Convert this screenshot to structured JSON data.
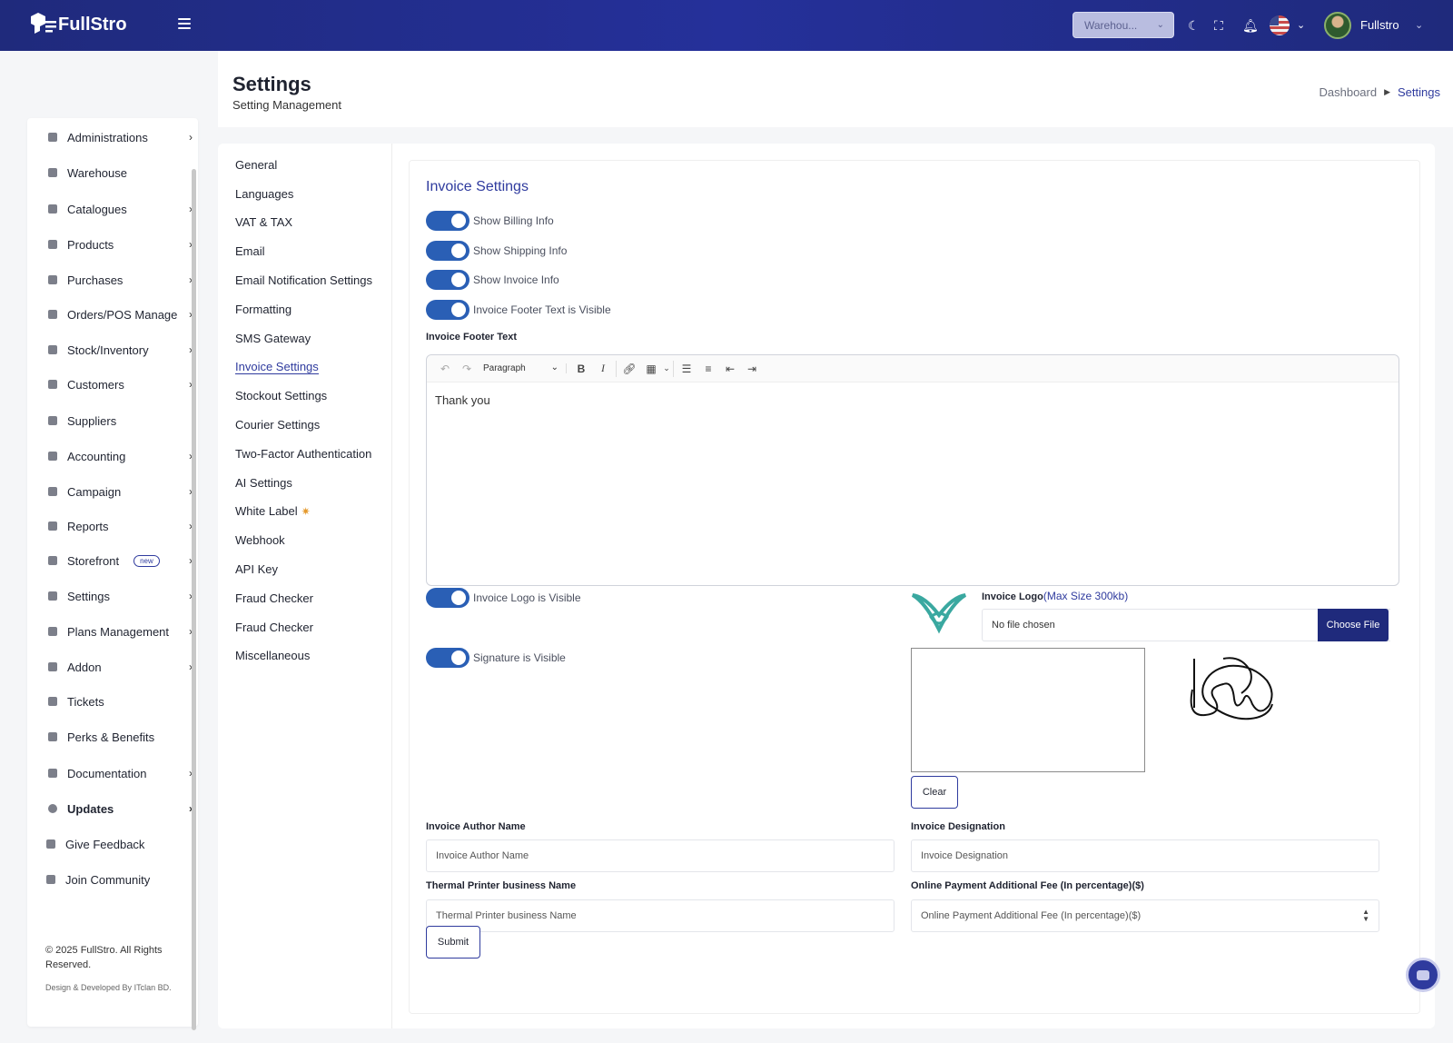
{
  "topbar": {
    "brand": "FullStro",
    "warehouse_select": "Warehou...",
    "user_name": "Fullstro",
    "icons": [
      "menu-icon",
      "moon-icon",
      "fullscreen-icon",
      "bell-icon",
      "flag-icon",
      "chevron-down-icon"
    ]
  },
  "header": {
    "title": "Settings",
    "subtitle": "Setting Management",
    "breadcrumb": {
      "home": "Dashboard",
      "current": "Settings"
    }
  },
  "sidebar": {
    "items": [
      {
        "label": "Administrations",
        "arrow": "›"
      },
      {
        "label": "Warehouse",
        "arrow": ""
      },
      {
        "label": "Catalogues",
        "arrow": "›"
      },
      {
        "label": "Products",
        "arrow": "›"
      },
      {
        "label": "Purchases",
        "arrow": "›"
      },
      {
        "label": "Orders/POS Manage",
        "arrow": "›"
      },
      {
        "label": "Stock/Inventory",
        "arrow": "›"
      },
      {
        "label": "Customers",
        "arrow": "›"
      },
      {
        "label": "Suppliers",
        "arrow": ""
      },
      {
        "label": "Accounting",
        "arrow": "›"
      },
      {
        "label": "Campaign",
        "arrow": "›"
      },
      {
        "label": "Reports",
        "arrow": "›"
      },
      {
        "label": "Storefront",
        "arrow": "›",
        "badge": "new"
      },
      {
        "label": "Settings",
        "arrow": "›"
      },
      {
        "label": "Plans Management",
        "arrow": "›"
      },
      {
        "label": "Addon",
        "arrow": "›"
      },
      {
        "label": "Tickets",
        "arrow": ""
      },
      {
        "label": "Perks & Benefits",
        "arrow": ""
      },
      {
        "label": "Documentation",
        "arrow": "›"
      },
      {
        "label": "Updates",
        "arrow": "›"
      },
      {
        "label": "Give Feedback",
        "arrow": ""
      },
      {
        "label": "Join Community",
        "arrow": ""
      }
    ],
    "copyright": "© 2025 FullStro. All Rights Reserved.",
    "credit_prefix": "Design & Developed By",
    "credit_company": "ITclan BD."
  },
  "settings_nav": {
    "items": [
      "General",
      "Languages",
      "VAT & TAX",
      "Email",
      "Email Notification Settings",
      "Formatting",
      "SMS Gateway",
      "Invoice Settings",
      "Stockout Settings",
      "Courier Settings",
      "Two-Factor Authentication",
      "AI Settings",
      "White Label",
      "Webhook",
      "API Key",
      "Fraud Checker",
      "Fraud Checker",
      "Miscellaneous"
    ],
    "active": "Invoice Settings"
  },
  "invoice": {
    "title": "Invoice Settings",
    "toggles": {
      "billing": "Show Billing Info",
      "shipping": "Show Shipping Info",
      "invoice": "Show Invoice Info",
      "footer": "Invoice Footer Text is Visible",
      "logo": "Invoice Logo is Visible",
      "signature": "Signature is Visible"
    },
    "footer_label": "Invoice Footer Text",
    "editor": {
      "paragraph": "Paragraph",
      "content": "Thank you"
    },
    "logo_label": "Invoice Logo",
    "logo_max": "(Max Size 300kb)",
    "file_placeholder": "No file chosen",
    "choose_file": "Choose File",
    "clear": "Clear",
    "author_label": "Invoice Author Name",
    "author_placeholder": "Invoice Author Name",
    "designation_label": "Invoice Designation",
    "designation_placeholder": "Invoice Designation",
    "thermal_label": "Thermal Printer business Name",
    "thermal_placeholder": "Thermal Printer business Name",
    "fee_label": "Online Payment Additional Fee (In percentage)($)",
    "fee_placeholder": "Online Payment Additional Fee (In percentage)($)",
    "submit": "Submit"
  },
  "colors": {
    "primary": "#2f3b9e",
    "topbar": "#1f2a7c",
    "toggle_on": "#2a5fb5",
    "logo_teal": "#3aa8a0"
  }
}
